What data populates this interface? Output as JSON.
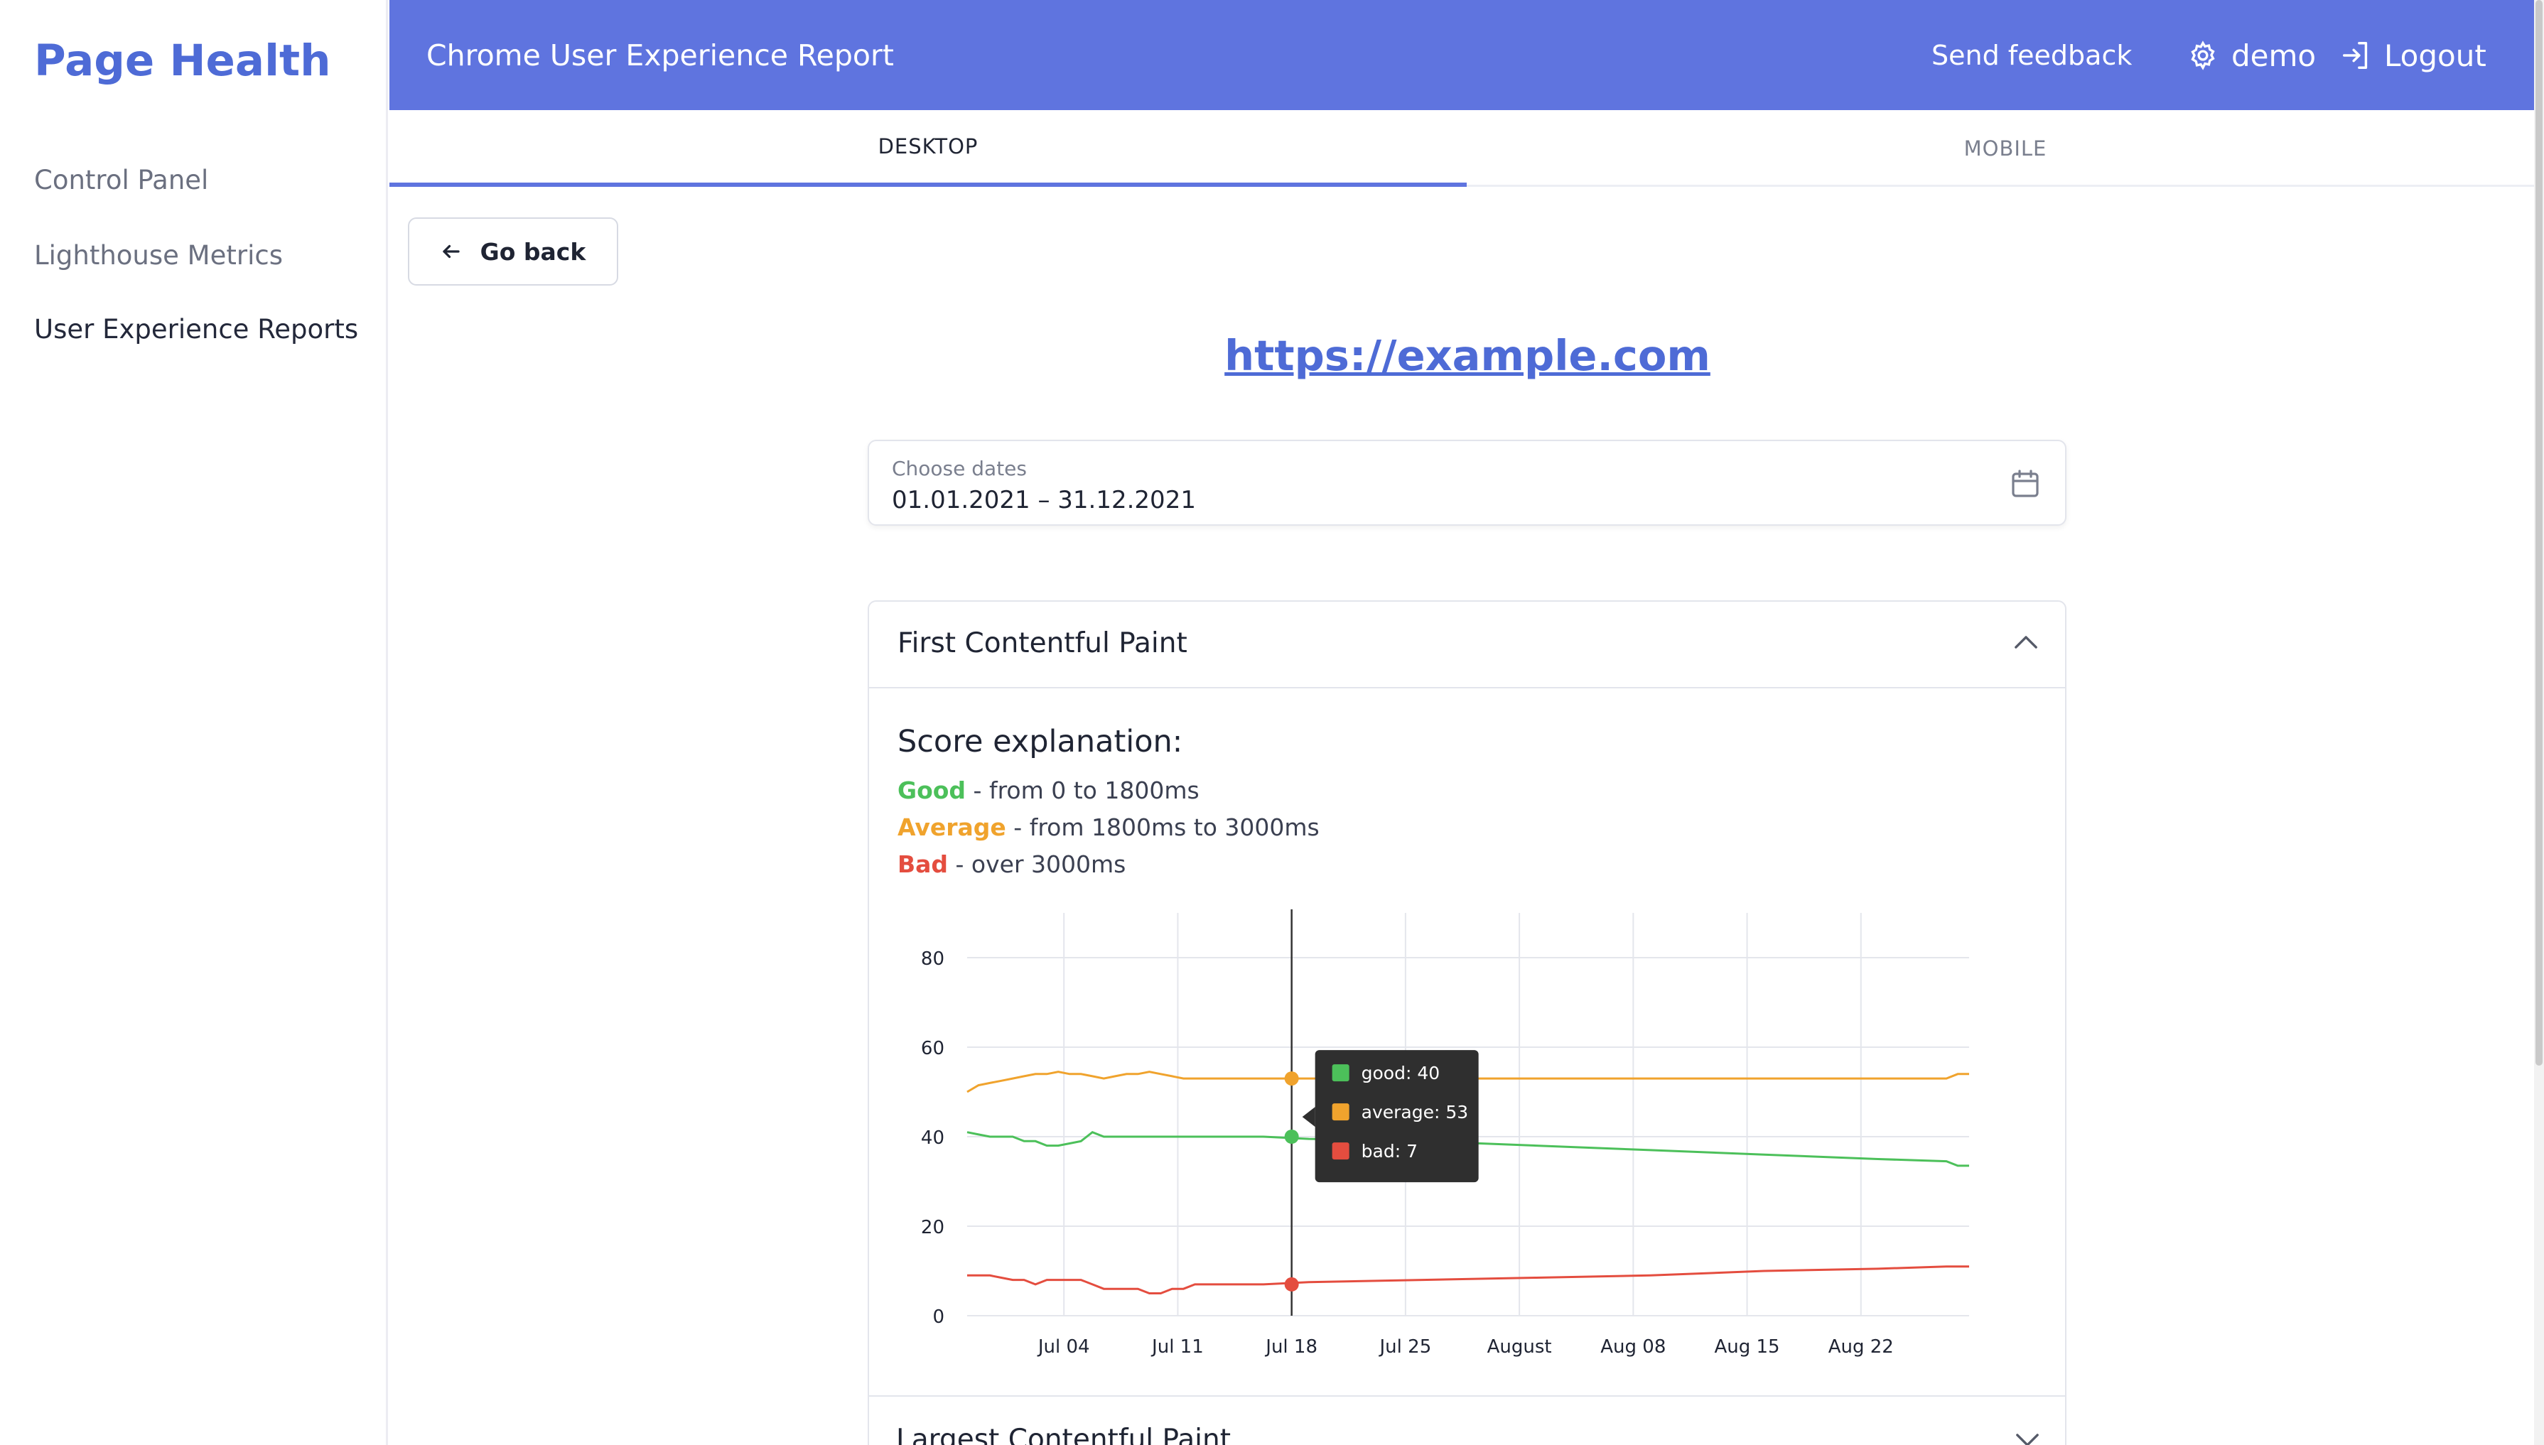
{
  "app": {
    "brand": "Page Health"
  },
  "sidebar": {
    "items": [
      {
        "label": "Control Panel"
      },
      {
        "label": "Lighthouse Metrics"
      },
      {
        "label": "User Experience Reports"
      }
    ]
  },
  "header": {
    "title": "Chrome User Experience Report",
    "feedback": "Send feedback",
    "user": "demo",
    "logout": "Logout",
    "color": "#5f74df"
  },
  "tabs": [
    {
      "label": "DESKTOP"
    },
    {
      "label": "MOBILE"
    }
  ],
  "go_back": "Go back",
  "site_url": "https://example.com",
  "date_picker": {
    "label": "Choose dates",
    "value": "01.01.2021 – 31.12.2021",
    "icon": "calendar-icon"
  },
  "panel": {
    "title": "First Contentful Paint",
    "score_title": "Score explanation:",
    "good": {
      "word": "Good",
      "rest": " - from 0 to 1800ms"
    },
    "average": {
      "word": "Average",
      "rest": " - from 1800ms to 3000ms"
    },
    "bad": {
      "word": "Bad",
      "rest": " - over 3000ms"
    }
  },
  "panel2": {
    "title": "Largest Contentful Paint"
  },
  "chart_data": {
    "type": "line",
    "x_ticks": [
      "Jul 04",
      "Jul 11",
      "Jul 18",
      "Jul 25",
      "August",
      "Aug 08",
      "Aug 15",
      "Aug 22"
    ],
    "y_ticks": [
      0,
      20,
      40,
      60,
      80
    ],
    "ylim": [
      0,
      90
    ],
    "grid": true,
    "series": [
      {
        "name": "good",
        "color": "#4cc05a",
        "values": [
          [
            0,
            41
          ],
          [
            1,
            40.5
          ],
          [
            2,
            40
          ],
          [
            3,
            40
          ],
          [
            4,
            40
          ],
          [
            5,
            39
          ],
          [
            6,
            39
          ],
          [
            7,
            38
          ],
          [
            8,
            38
          ],
          [
            9,
            38.5
          ],
          [
            10,
            39
          ],
          [
            11,
            41
          ],
          [
            12,
            40
          ],
          [
            13,
            40
          ],
          [
            14,
            40
          ],
          [
            15,
            40
          ],
          [
            16,
            40
          ],
          [
            17,
            40
          ],
          [
            18,
            40
          ],
          [
            19,
            40
          ],
          [
            20,
            40
          ],
          [
            21,
            40
          ],
          [
            22,
            40
          ],
          [
            23,
            40
          ],
          [
            24,
            40
          ],
          [
            25,
            40
          ],
          [
            26,
            40
          ],
          [
            30,
            39.5
          ],
          [
            40,
            39
          ],
          [
            50,
            38
          ],
          [
            60,
            37
          ],
          [
            70,
            36
          ],
          [
            80,
            35
          ],
          [
            86,
            34.5
          ],
          [
            87,
            33.5
          ],
          [
            88,
            33.5
          ]
        ]
      },
      {
        "name": "average",
        "color": "#f0a32d",
        "values": [
          [
            0,
            50
          ],
          [
            1,
            51.5
          ],
          [
            2,
            52
          ],
          [
            3,
            52.5
          ],
          [
            4,
            53
          ],
          [
            5,
            53.5
          ],
          [
            6,
            54
          ],
          [
            7,
            54
          ],
          [
            8,
            54.5
          ],
          [
            9,
            54
          ],
          [
            10,
            54
          ],
          [
            11,
            53.5
          ],
          [
            12,
            53
          ],
          [
            13,
            53.5
          ],
          [
            14,
            54
          ],
          [
            15,
            54
          ],
          [
            16,
            54.5
          ],
          [
            17,
            54
          ],
          [
            18,
            53.5
          ],
          [
            19,
            53
          ],
          [
            20,
            53
          ],
          [
            21,
            53
          ],
          [
            22,
            53
          ],
          [
            23,
            53
          ],
          [
            24,
            53
          ],
          [
            25,
            53
          ],
          [
            26,
            53
          ],
          [
            30,
            53
          ],
          [
            40,
            53
          ],
          [
            50,
            53
          ],
          [
            60,
            53
          ],
          [
            70,
            53
          ],
          [
            80,
            53
          ],
          [
            86,
            53
          ],
          [
            87,
            54
          ],
          [
            88,
            54
          ]
        ]
      },
      {
        "name": "bad",
        "color": "#e44d3f",
        "values": [
          [
            0,
            9
          ],
          [
            1,
            9
          ],
          [
            2,
            9
          ],
          [
            3,
            8.5
          ],
          [
            4,
            8
          ],
          [
            5,
            8
          ],
          [
            6,
            7
          ],
          [
            7,
            8
          ],
          [
            8,
            8
          ],
          [
            9,
            8
          ],
          [
            10,
            8
          ],
          [
            11,
            7
          ],
          [
            12,
            6
          ],
          [
            13,
            6
          ],
          [
            14,
            6
          ],
          [
            15,
            6
          ],
          [
            16,
            5
          ],
          [
            17,
            5
          ],
          [
            18,
            6
          ],
          [
            19,
            6
          ],
          [
            20,
            7
          ],
          [
            21,
            7
          ],
          [
            22,
            7
          ],
          [
            23,
            7
          ],
          [
            24,
            7
          ],
          [
            25,
            7
          ],
          [
            26,
            7
          ],
          [
            30,
            7.5
          ],
          [
            40,
            8
          ],
          [
            50,
            8.5
          ],
          [
            60,
            9
          ],
          [
            70,
            10
          ],
          [
            80,
            10.5
          ],
          [
            86,
            11
          ],
          [
            87,
            11
          ],
          [
            88,
            11
          ]
        ]
      }
    ],
    "x_range": [
      0,
      88
    ],
    "tick_positions": [
      8.5,
      18.5,
      28.5,
      38.5,
      48.5,
      58.5,
      68.5,
      78.5
    ],
    "hover": {
      "x": 28.5,
      "label_good": "good: 40",
      "label_average": "average: 53",
      "label_bad": "bad: 7",
      "good": 40,
      "average": 53,
      "bad": 7
    }
  }
}
